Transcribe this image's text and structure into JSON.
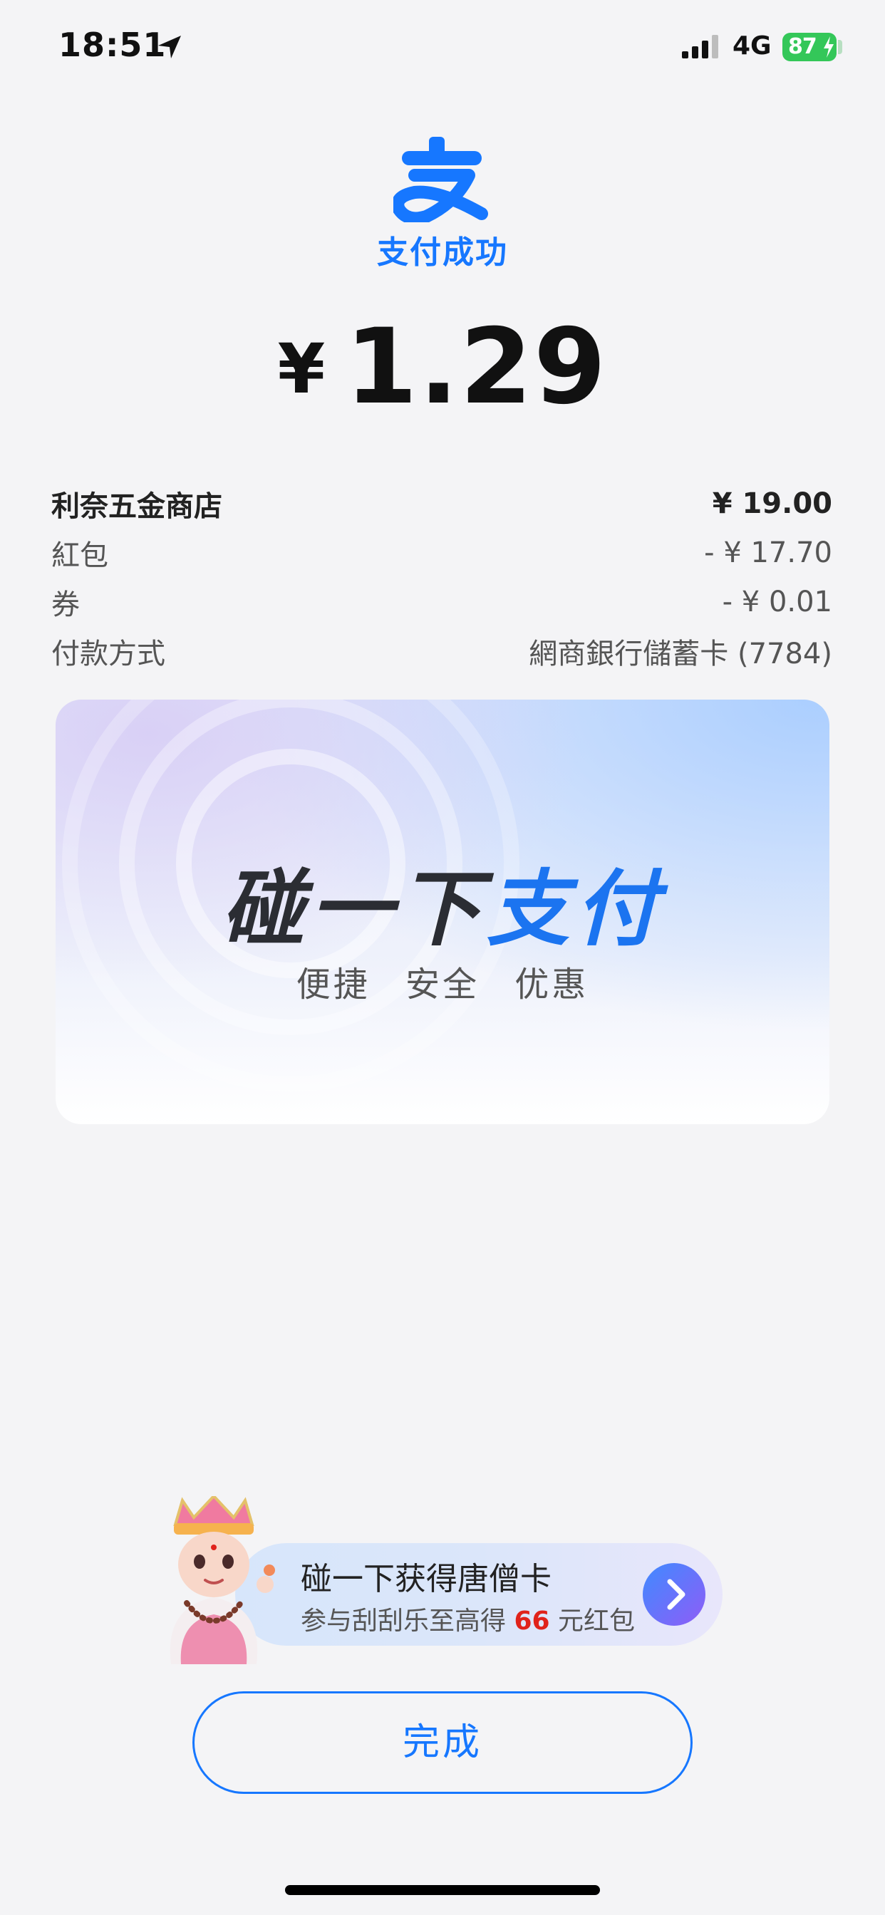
{
  "status_bar": {
    "time": "18:51",
    "network": "4G",
    "battery": "87",
    "icons": [
      "location-arrow-icon",
      "signal-icon",
      "battery-charging-icon"
    ]
  },
  "header": {
    "logo_icon": "alipay-logo",
    "title": "支付成功",
    "accent_color": "#1677ff"
  },
  "amount": {
    "currency": "¥",
    "value": "1.29"
  },
  "details": [
    {
      "label": "利奈五金商店",
      "value": "¥ 19.00"
    },
    {
      "label": "紅包",
      "value": "- ¥ 17.70"
    },
    {
      "label": "券",
      "value": "- ¥ 0.01"
    },
    {
      "label": "付款方式",
      "value": "網商銀行儲蓄卡 (7784)"
    }
  ],
  "promo": {
    "title_dark": "碰一下",
    "title_blue": "支付",
    "subtitle": "便捷 安全 优惠"
  },
  "tang_card": {
    "title": "碰一下获得唐僧卡",
    "sub_prefix": "参与刮刮乐至高得",
    "sub_highlight": "66",
    "sub_suffix": "元红包",
    "highlight_color": "#e0231b"
  },
  "done_button": {
    "label": "完成"
  }
}
